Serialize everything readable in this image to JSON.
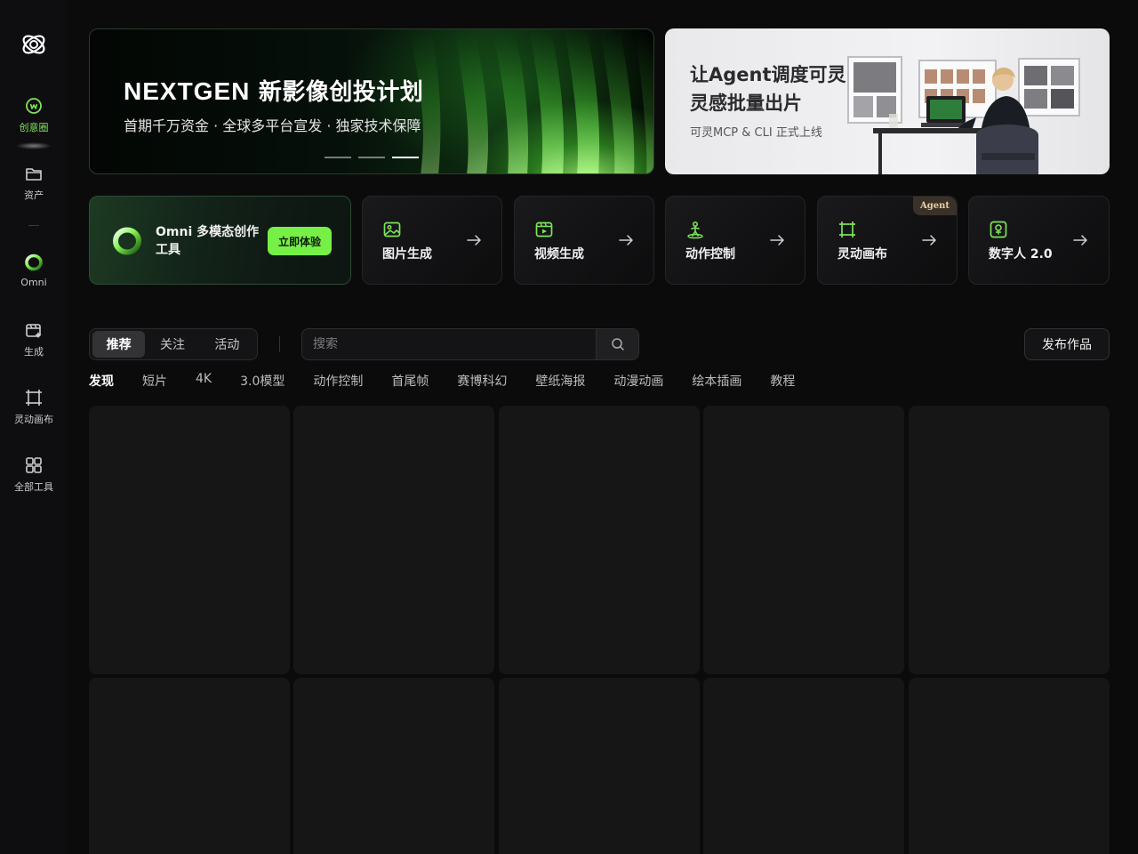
{
  "sidebar": {
    "items": [
      {
        "label": "创意圈",
        "icon": "community-icon",
        "active": true
      },
      {
        "label": "资产",
        "icon": "folder-icon",
        "active": false
      },
      {
        "label": "Omni",
        "icon": "omni-ring-icon",
        "active": false
      },
      {
        "label": "生成",
        "icon": "generate-icon",
        "active": false
      },
      {
        "label": "灵动画布",
        "icon": "canvas-icon",
        "active": false
      },
      {
        "label": "全部工具",
        "icon": "grid-icon",
        "active": false
      }
    ]
  },
  "banner_main": {
    "brand": "NEXTGEN",
    "title": "新影像创投计划",
    "subtitle": "首期千万资金 · 全球多平台宣发 · 独家技术保障",
    "slides": 3,
    "active_slide": 3
  },
  "banner_side": {
    "title": "让Agent调度可灵，灵感批量出片",
    "subtitle": "可灵MCP & CLI 正式上线"
  },
  "omni_card": {
    "title": "Omni 多模态创作工具",
    "button": "立即体验"
  },
  "tools": [
    {
      "label": "图片生成",
      "icon": "image-icon"
    },
    {
      "label": "视频生成",
      "icon": "video-icon"
    },
    {
      "label": "动作控制",
      "icon": "motion-icon"
    },
    {
      "label": "灵动画布",
      "icon": "canvas-icon",
      "tag": "Agent"
    },
    {
      "label": "数字人 2.0",
      "icon": "avatar-icon"
    }
  ],
  "feed": {
    "tabs": [
      "推荐",
      "关注",
      "活动"
    ],
    "active_tab": "推荐",
    "search_placeholder": "搜索",
    "publish": "发布作品",
    "categories": [
      "发现",
      "短片",
      "4K",
      "3.0模型",
      "动作控制",
      "首尾帧",
      "赛博科幻",
      "壁纸海报",
      "动漫动画",
      "绘本插画",
      "教程"
    ],
    "active_category": "发现"
  },
  "colors": {
    "accent": "#76f047",
    "background": "#0b0b0c",
    "card": "#161617"
  }
}
